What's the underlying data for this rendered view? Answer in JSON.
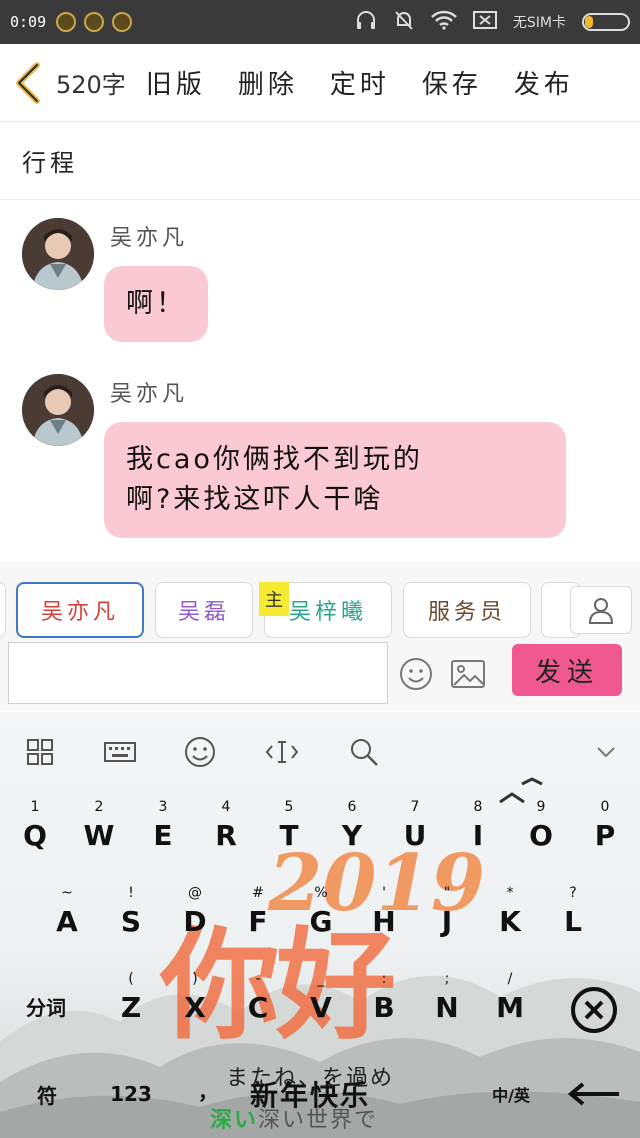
{
  "status_bar": {
    "time": "0:09",
    "sim_label": "无SIM卡",
    "battery_level": 0.2
  },
  "header": {
    "word_count": "520字",
    "old_version": "旧版",
    "delete": "删除",
    "schedule": "定时",
    "save": "保存",
    "publish": "发布"
  },
  "title": "行程",
  "messages": [
    {
      "sender": "吴亦凡",
      "text": "啊！"
    },
    {
      "sender": "吴亦凡",
      "text_lines": [
        "我cao你俩找不到玩的",
        "啊?来找这吓人干啥"
      ]
    }
  ],
  "chips": {
    "items": [
      "吴亦凡",
      "吴磊",
      "吴梓曦",
      "服务员"
    ],
    "selected": "吴亦凡",
    "owner_tag": "主"
  },
  "composer": {
    "input_value": "",
    "send_label": "发送"
  },
  "keyboard": {
    "row1": [
      {
        "sub": "1",
        "key": "Q"
      },
      {
        "sub": "2",
        "key": "W"
      },
      {
        "sub": "3",
        "key": "E"
      },
      {
        "sub": "4",
        "key": "R"
      },
      {
        "sub": "5",
        "key": "T"
      },
      {
        "sub": "6",
        "key": "Y"
      },
      {
        "sub": "7",
        "key": "U"
      },
      {
        "sub": "8",
        "key": "I"
      },
      {
        "sub": "9",
        "key": "O"
      },
      {
        "sub": "0",
        "key": "P"
      }
    ],
    "row2": [
      {
        "sub": "~",
        "key": "A"
      },
      {
        "sub": "!",
        "key": "S"
      },
      {
        "sub": "@",
        "key": "D"
      },
      {
        "sub": "#",
        "key": "F"
      },
      {
        "sub": "%",
        "key": "G"
      },
      {
        "sub": "'",
        "key": "H"
      },
      {
        "sub": "\"",
        "key": "J"
      },
      {
        "sub": "*",
        "key": "K"
      },
      {
        "sub": "?",
        "key": "L"
      }
    ],
    "row3": [
      {
        "sub": "(",
        "key": "Z"
      },
      {
        "sub": ")",
        "key": "X"
      },
      {
        "sub": "-",
        "key": "C"
      },
      {
        "sub": "_",
        "key": "V"
      },
      {
        "sub": ":",
        "key": "B"
      },
      {
        "sub": ";",
        "key": "N"
      },
      {
        "sub": "/",
        "key": "M"
      }
    ],
    "segment_label": "分词",
    "symbols_label": "符",
    "numbers_label": "123",
    "comma": "，",
    "lang_label": "中/英",
    "banner_year": "2019",
    "banner_greeting": "你好",
    "banner_new_year": "新年快乐",
    "lyric_line1": "またね、を過め",
    "lyric_line2_highlight": "深い",
    "lyric_line2_rest": "深い世界で"
  },
  "colors": {
    "bubble": "#fbc9d4",
    "send_button": "#f0598f",
    "selected_chip_border": "#3e78c8",
    "owner_tag": "#f7ea33"
  }
}
